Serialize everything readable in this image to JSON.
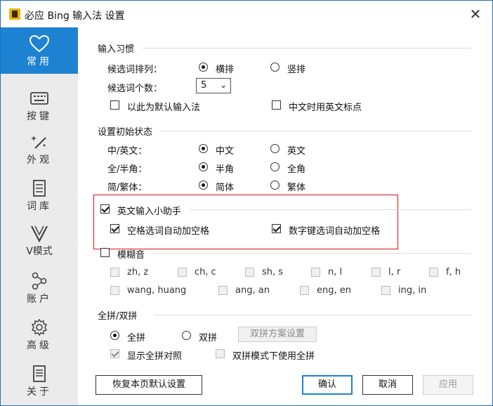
{
  "window": {
    "title": "必应 Bing 输入法 设置",
    "close": "✕"
  },
  "sidebar": {
    "items": [
      {
        "label": "常用",
        "icon": "heart-icon",
        "active": true
      },
      {
        "label": "按键",
        "icon": "keyboard-icon"
      },
      {
        "label": "外观",
        "icon": "magic-wand-icon"
      },
      {
        "label": "词库",
        "icon": "book-icon"
      },
      {
        "label": "V模式",
        "icon": "v-icon"
      },
      {
        "label": "账户",
        "icon": "share-nodes-icon"
      },
      {
        "label": "高级",
        "icon": "gear-icon"
      },
      {
        "label": "关于",
        "icon": "document-icon"
      }
    ]
  },
  "habits": {
    "title": "输入习惯",
    "layout_label": "候选词排列：",
    "horizontal": "横排",
    "vertical": "竖排",
    "count_label": "候选词个数：",
    "count_value": "5",
    "default_ime": "以此为默认输入法",
    "en_punct": "中文时用英文标点"
  },
  "initial": {
    "title": "设置初始状态",
    "cn_en_label": "中/英文：",
    "cn": "中文",
    "en": "英文",
    "width_label": "全/半角：",
    "half": "半角",
    "full": "全角",
    "script_label": "简/繁体：",
    "simplified": "简体",
    "traditional": "繁体"
  },
  "english_helper": {
    "title": "英文输入小助手",
    "space_auto": "空格选词自动加空格",
    "digit_auto": "数字键选词自动加空格"
  },
  "fuzzy": {
    "title": "模糊音",
    "row1": [
      "zh, z",
      "ch, c",
      "sh, s",
      "n, l",
      "l, r",
      "f, h"
    ],
    "row2": [
      "wang, huang",
      "ang, an",
      "eng, en",
      "ing, in"
    ]
  },
  "pinyin": {
    "title": "全拼/双拼",
    "full": "全拼",
    "double": "双拼",
    "scheme_button": "双拼方案设置",
    "show_full": "显示全拼对照",
    "double_use_full": "双拼模式下使用全拼"
  },
  "footer": {
    "restore": "恢复本页默认设置",
    "ok": "确认",
    "cancel": "取消",
    "apply": "应用"
  },
  "colors": {
    "accent": "#1e82d2",
    "highlight": "#d11111",
    "sidebar_bg": "#ebebeb"
  }
}
